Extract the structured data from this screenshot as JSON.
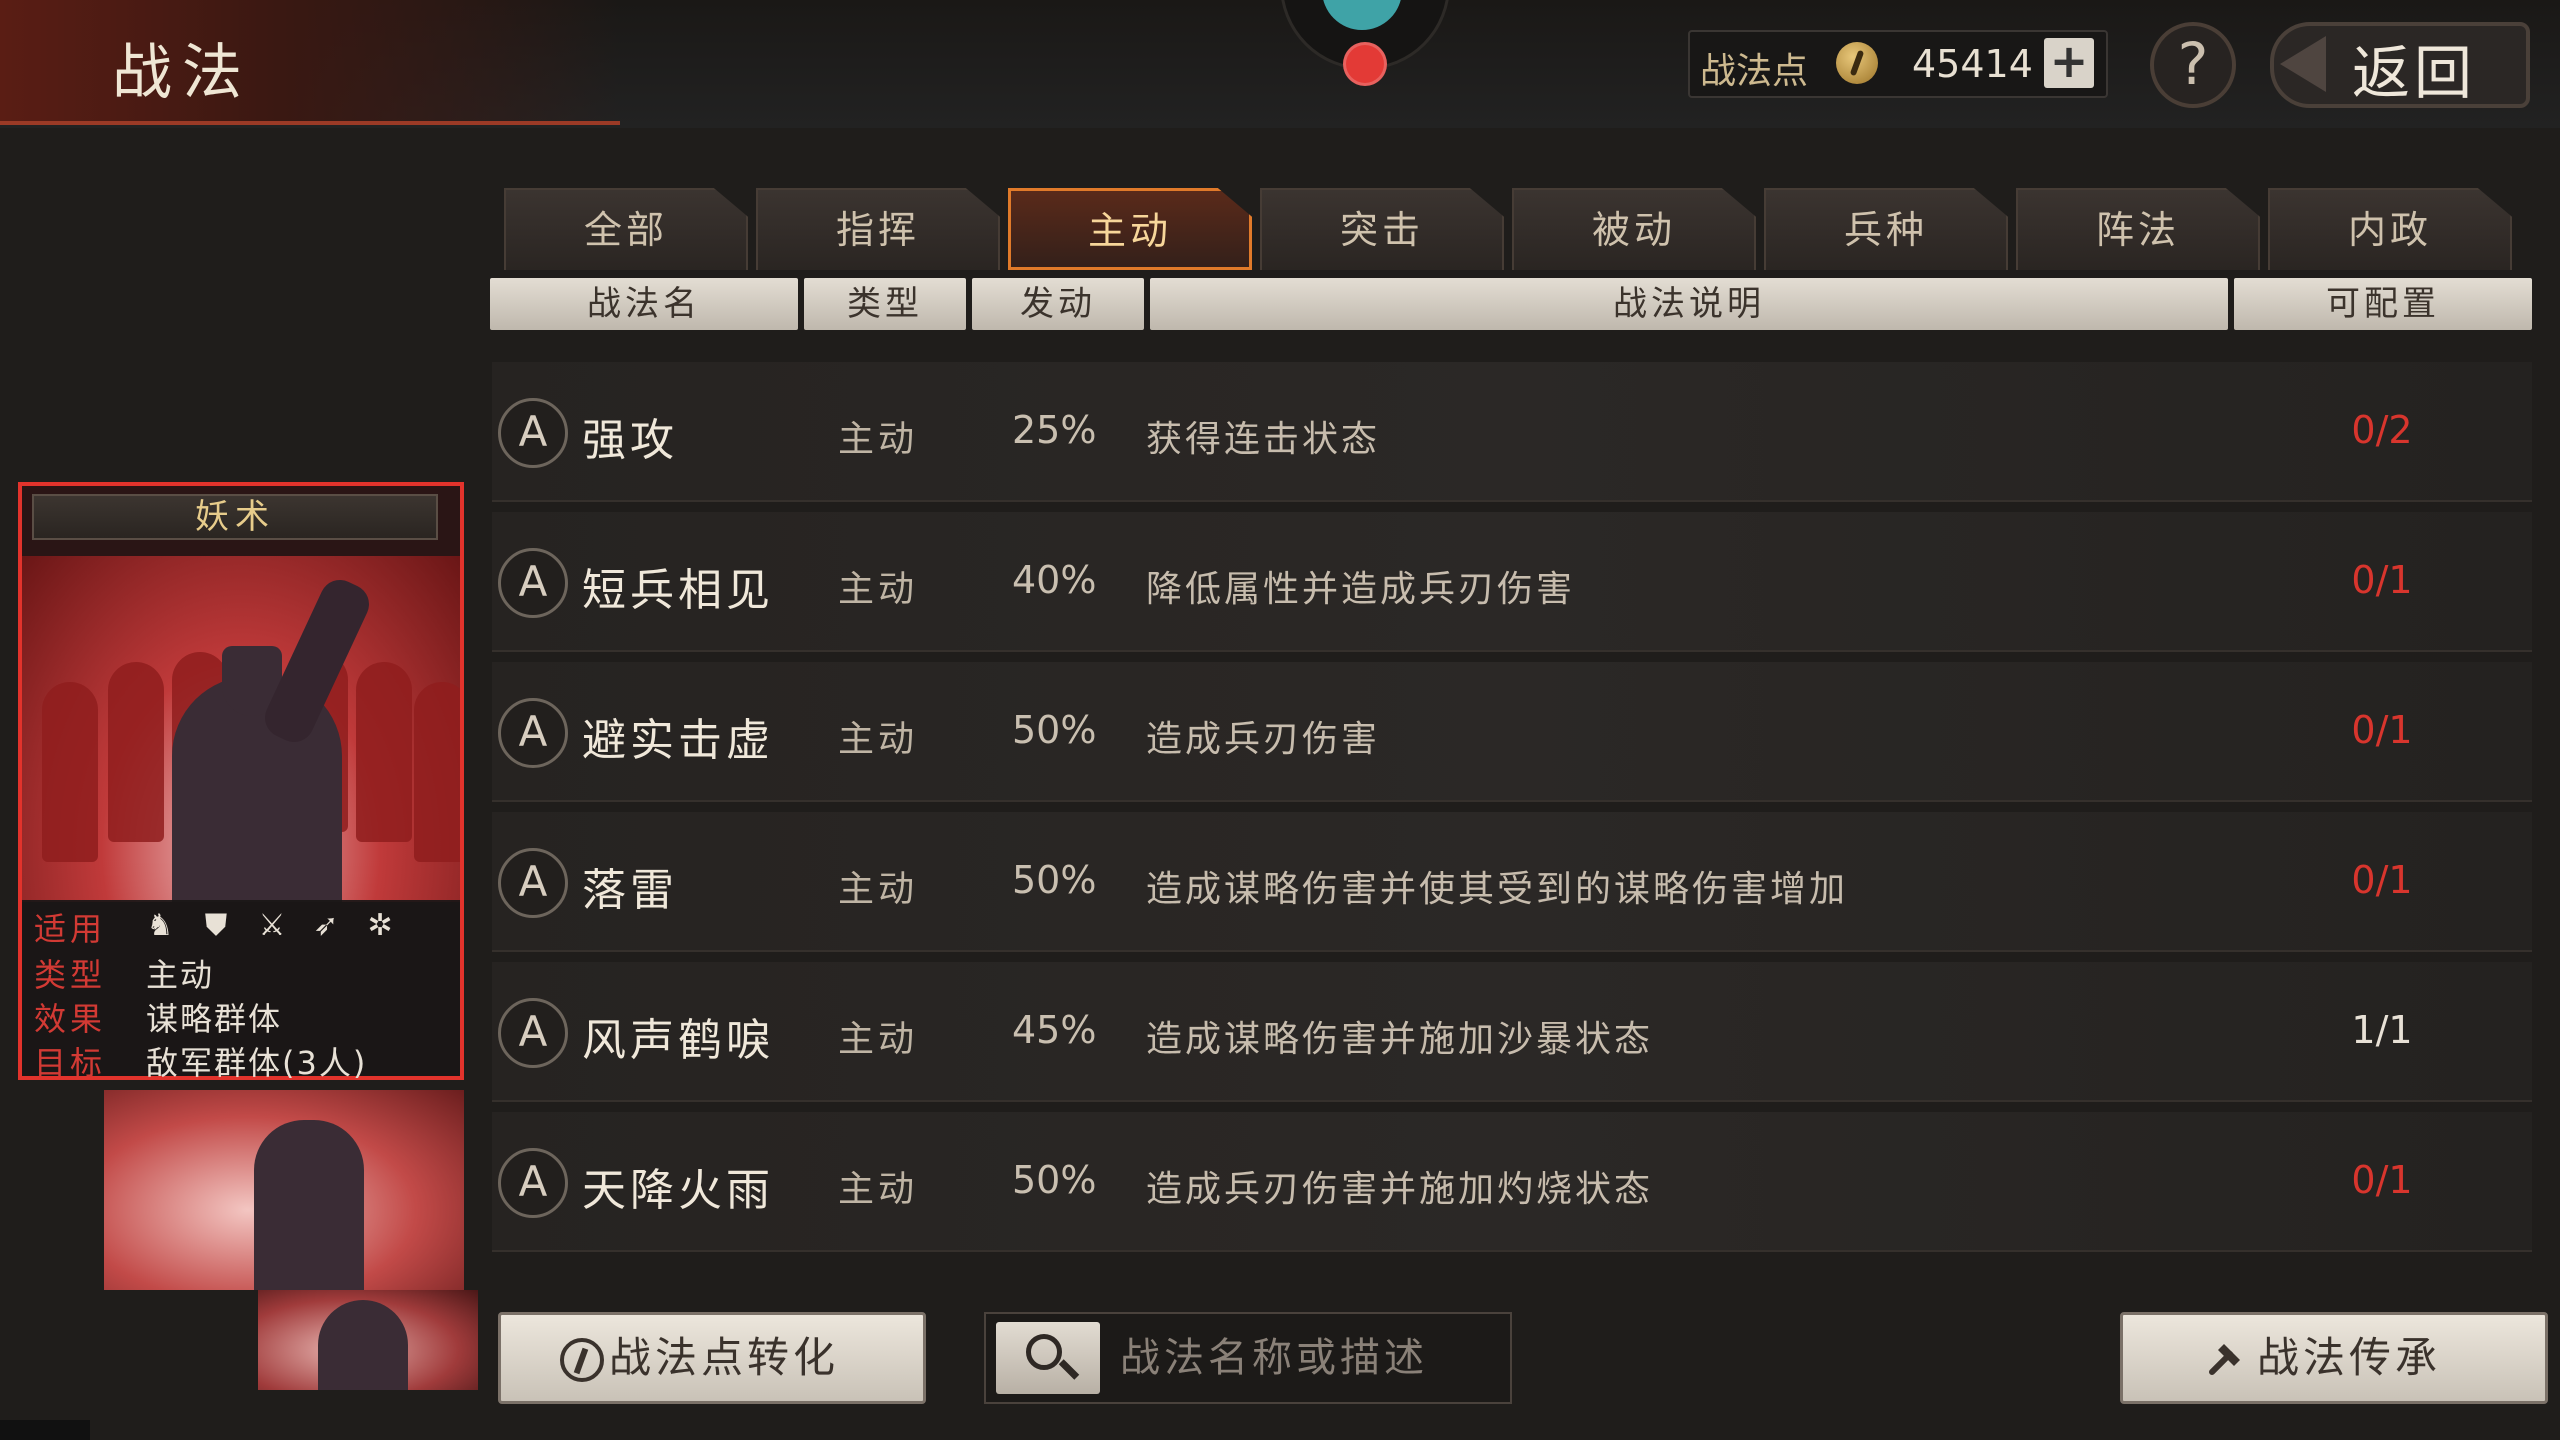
{
  "header": {
    "title": "战法",
    "points_label": "战法点",
    "points_value": "45414",
    "plus": "+",
    "help": "?",
    "back": "返回"
  },
  "tabs": [
    {
      "label": "全部",
      "active": false
    },
    {
      "label": "指挥",
      "active": false
    },
    {
      "label": "主动",
      "active": true
    },
    {
      "label": "突击",
      "active": false
    },
    {
      "label": "被动",
      "active": false
    },
    {
      "label": "兵种",
      "active": false
    },
    {
      "label": "阵法",
      "active": false
    },
    {
      "label": "内政",
      "active": false
    }
  ],
  "columns": {
    "name": "战法名",
    "type": "类型",
    "rate": "发动",
    "desc": "战法说明",
    "config": "可配置"
  },
  "rows": [
    {
      "grade": "A",
      "name": "强攻",
      "type": "主动",
      "rate": "25%",
      "desc": "获得连击状态",
      "config": "0/2",
      "full": false
    },
    {
      "grade": "A",
      "name": "短兵相见",
      "type": "主动",
      "rate": "40%",
      "desc": "降低属性并造成兵刃伤害",
      "config": "0/1",
      "full": false
    },
    {
      "grade": "A",
      "name": "避实击虚",
      "type": "主动",
      "rate": "50%",
      "desc": "造成兵刃伤害",
      "config": "0/1",
      "full": false
    },
    {
      "grade": "A",
      "name": "落雷",
      "type": "主动",
      "rate": "50%",
      "desc": "造成谋略伤害并使其受到的谋略伤害增加",
      "config": "0/1",
      "full": false
    },
    {
      "grade": "A",
      "name": "风声鹤唳",
      "type": "主动",
      "rate": "45%",
      "desc": "造成谋略伤害并施加沙暴状态",
      "config": "1/1",
      "full": true
    },
    {
      "grade": "A",
      "name": "天降火雨",
      "type": "主动",
      "rate": "50%",
      "desc": "造成兵刃伤害并施加灼烧状态",
      "config": "0/1",
      "full": false
    }
  ],
  "card": {
    "title": "妖术",
    "apply_label": "适用",
    "type_label": "类型",
    "type_value": "主动",
    "effect_label": "效果",
    "effect_value": "谋略群体",
    "target_label": "目标",
    "target_value": "敌军群体(3人)",
    "unit_icons": [
      "cavalry-icon",
      "shield-icon",
      "crossed-swords-icon",
      "spear-icon",
      "wheel-icon"
    ]
  },
  "bottom": {
    "convert_label": "战法点转化",
    "search_placeholder": "战法名称或描述",
    "inherit_label": "战法传承"
  },
  "colors": {
    "accent_red": "#d8352d",
    "tab_active_border": "#e07a2a",
    "card_border": "#e2332c"
  }
}
